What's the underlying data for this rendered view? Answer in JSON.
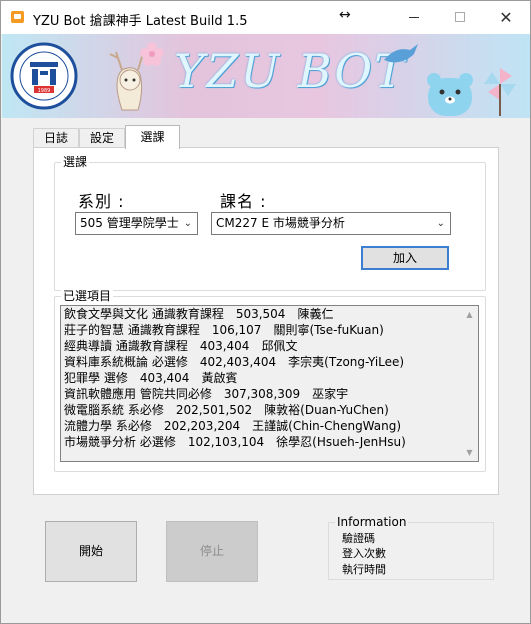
{
  "window": {
    "title": "YZU Bot  搶課神手 Latest Build 1.5",
    "move_glyph": "↔",
    "min_label": "",
    "max_label": "",
    "close_label": "✕"
  },
  "banner": {
    "title": "YZU BOT",
    "logo_year": "1989",
    "logo_text": "YUAN ZE UNIVERSITY"
  },
  "tabs": [
    {
      "label": "日誌"
    },
    {
      "label": "設定"
    },
    {
      "label": "選課"
    }
  ],
  "select_group": {
    "legend": "選課",
    "dept_label": "系別 :",
    "course_label": "課名 :",
    "dept_value": "505 管理學院學士",
    "course_value": "CM227 E 市場競爭分析",
    "add_button": "加入"
  },
  "selected_group": {
    "legend": "已選項目",
    "items": [
      "飲食文學與文化 通識教育課程　503,504　陳義仁",
      "莊子的智慧 通識教育課程　106,107　關則寧(Tse-fuKuan)",
      "經典導讀 通識教育課程　403,404　邱佩文",
      "資料庫系統概論 必選修　402,403,404　李宗夷(Tzong-YiLee)",
      "犯罪學 選修　403,404　黃啟賓",
      "資訊軟體應用 管院共同必修　307,308,309　巫家宇",
      "微電腦系統 系必修　202,501,502　陳敦裕(Duan-YuChen)",
      "流體力學 系必修　202,203,204　王謹誠(Chin-ChengWang)",
      "市場競爭分析 必選修　102,103,104　徐學忍(Hsueh-JenHsu)"
    ]
  },
  "buttons": {
    "start": "開始",
    "stop": "停止"
  },
  "info": {
    "legend": "Information",
    "captcha": "驗證碼",
    "login_count": "登入次數",
    "run_time": "執行時間"
  },
  "colors": {
    "window_bg": "#f0f0f0",
    "accent_border": "#3c7fd1",
    "banner_text": "#dff6ff"
  }
}
